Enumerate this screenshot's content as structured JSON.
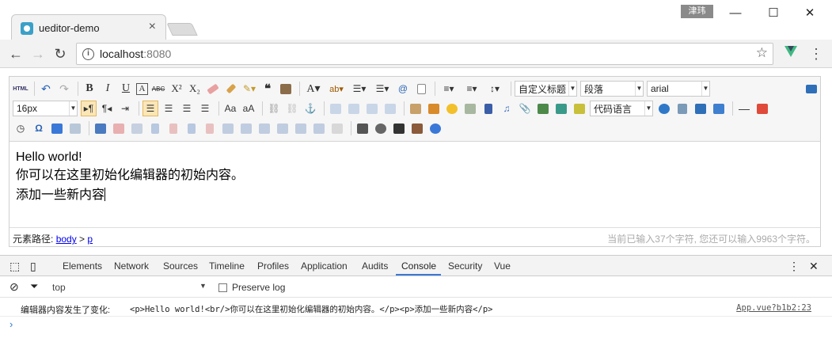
{
  "browser": {
    "tab_title": "ueditor-demo",
    "user_badge": "津玮",
    "url_host": "localhost",
    "url_port": ":8080",
    "window_controls": {
      "minimize": "—",
      "maximize": "☐",
      "close": "✕"
    }
  },
  "editor": {
    "toolbar_combos": {
      "custom_title": "自定义标题",
      "paragraph": "段落",
      "font_family": "arial",
      "font_size": "16px",
      "code_language": "代码语言"
    },
    "content": {
      "line1": "Hello world!",
      "line2": "你可以在这里初始化编辑器的初始内容。",
      "line3": "添加一些新内容"
    },
    "status": {
      "path_label": "元素路径:",
      "path_body": "body",
      "path_sep": " > ",
      "path_p": "p",
      "wordcount": "当前已输入37个字符, 您还可以输入9963个字符。"
    }
  },
  "devtools": {
    "tabs": [
      "Elements",
      "Network",
      "Sources",
      "Timeline",
      "Profiles",
      "Application",
      "Audits",
      "Console",
      "Security",
      "Vue"
    ],
    "active_tab": "Console",
    "context": "top",
    "preserve_log": "Preserve log",
    "message": {
      "label": "编辑器内容发生了变化:",
      "code": "<p>Hello world!<br/>你可以在这里初始化编辑器的初始内容。</p><p>添加一些新内容</p>",
      "source": "App.vue?b1b2:23"
    },
    "prompt": "›"
  },
  "colors": {
    "accent": "#3a78d8",
    "vue_green": "#41b883",
    "selected_button": "#fbe6b8"
  }
}
